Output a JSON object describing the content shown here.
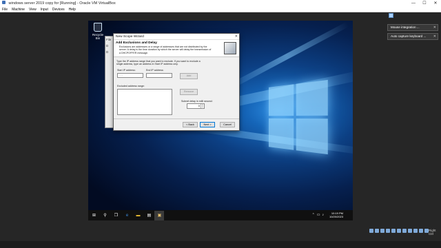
{
  "window": {
    "title": "windows server 2019 copy for [Running] - Oracle VM VirtualBox",
    "controls": [
      "—",
      "☐",
      "✕"
    ]
  },
  "menu": [
    "File",
    "Machine",
    "View",
    "Input",
    "Devices",
    "Help"
  ],
  "desktop": {
    "recycle_bin_label": "Recycle Bin"
  },
  "server_manager": {
    "side_items": [
      "File",
      "D",
      "D"
    ],
    "highlight": "◀"
  },
  "wizard": {
    "title": "New Scope Wizard",
    "close": "✕",
    "header_title": "Add Exclusions and Delay",
    "header_desc": "Exclusions are addresses or a range of addresses that are not distributed by the server. A delay is the time duration by which the server will delay the transmission of a DHCPOFFER message.",
    "instructions": "Type the IP address range that you want to exclude. If you want to exclude a single address, type an address in Start IP address only.",
    "start_ip_label": "Start IP address:",
    "start_ip_value": ". . .",
    "end_ip_label": "End IP address:",
    "end_ip_value": "",
    "add_label": "Add",
    "excluded_label": "Excluded address range:",
    "remove_label": "Remove",
    "subnet_delay_label": "Subnet delay in milli second:",
    "subnet_delay_value": "0",
    "back_label": "< Back",
    "next_label": "Next >",
    "cancel_label": "Cancel"
  },
  "taskbar": {
    "time": "10:19 PM",
    "date": "10/20/2023"
  },
  "notifications": [
    "Mouse integration ...",
    "Auto capture keyboard ..."
  ],
  "statusbar": {
    "host_key": "Right Ctrl"
  }
}
